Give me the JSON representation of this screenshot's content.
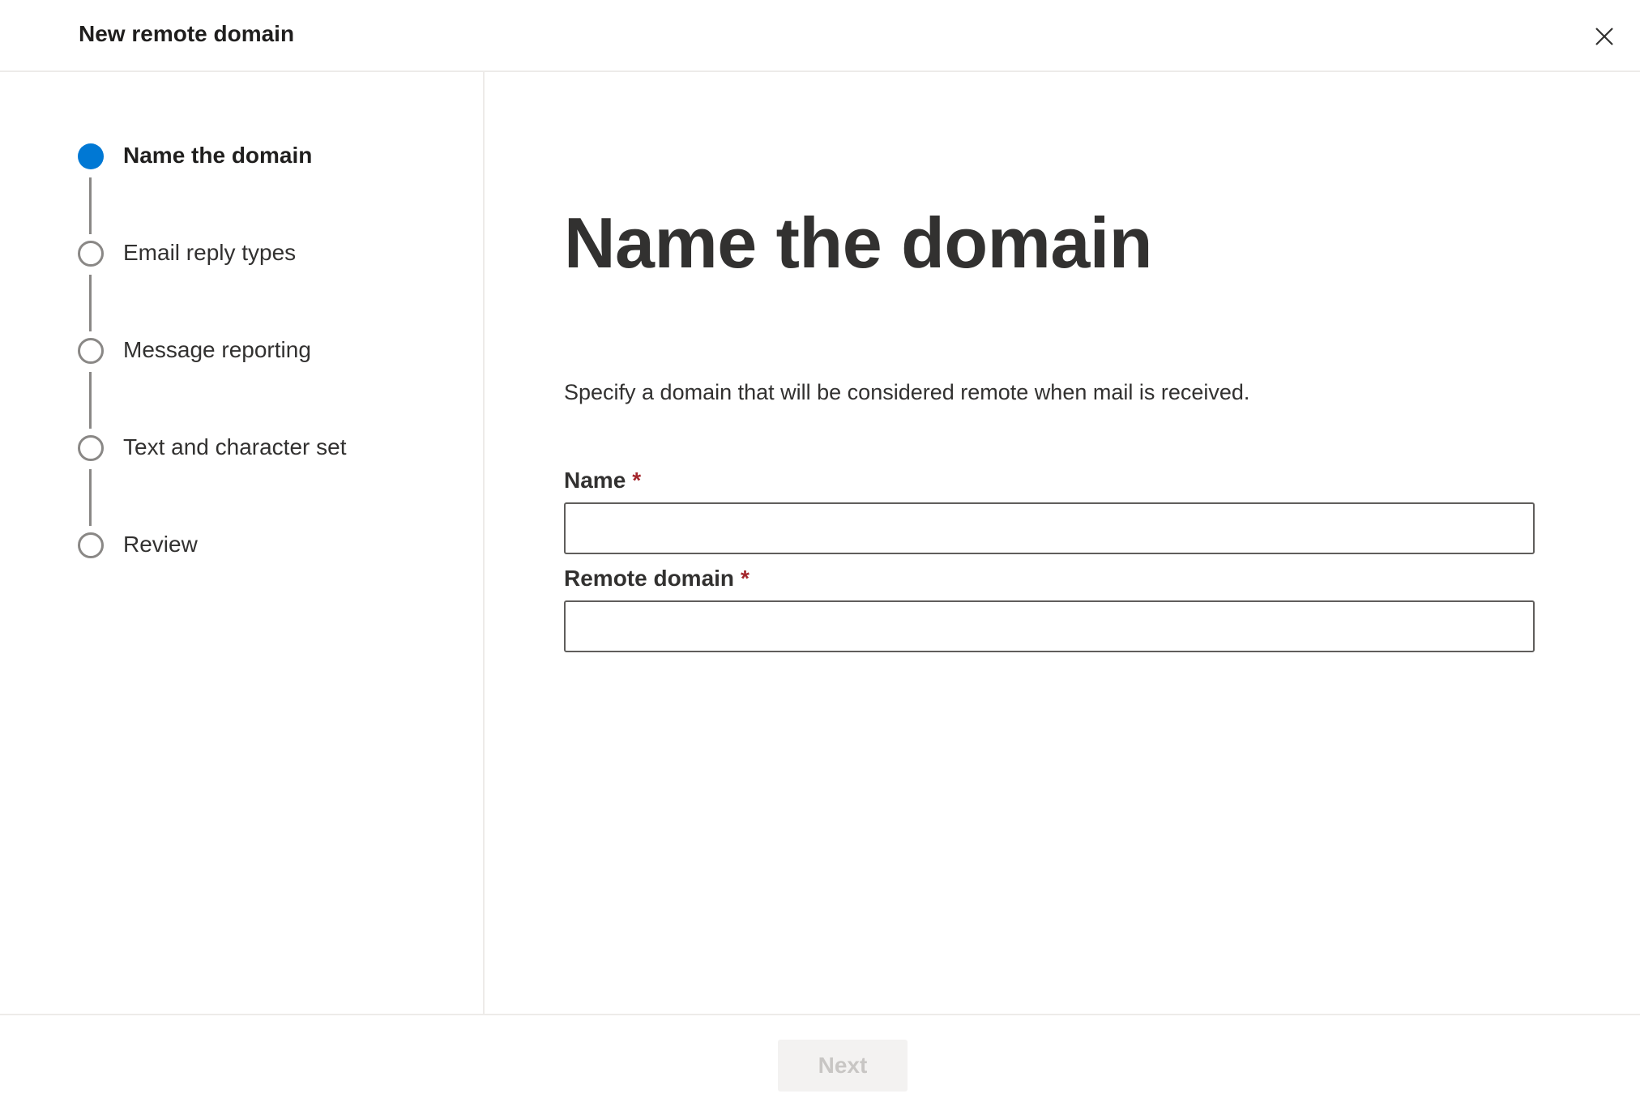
{
  "header": {
    "title": "New remote domain",
    "close_icon": "close-icon"
  },
  "steps": [
    {
      "label": "Name the domain",
      "state": "active"
    },
    {
      "label": "Email reply types",
      "state": "inactive"
    },
    {
      "label": "Message reporting",
      "state": "inactive"
    },
    {
      "label": "Text and character set",
      "state": "inactive"
    },
    {
      "label": "Review",
      "state": "inactive"
    }
  ],
  "main": {
    "title": "Name the domain",
    "description": "Specify a domain that will be considered remote when mail is received.",
    "fields": {
      "name": {
        "label": "Name",
        "required_mark": "*",
        "value": ""
      },
      "remote_domain": {
        "label": "Remote domain",
        "required_mark": "*",
        "value": ""
      }
    }
  },
  "footer": {
    "next_label": "Next",
    "next_enabled": false
  },
  "colors": {
    "accent": "#0078d4",
    "required": "#a4262c",
    "disabled_text": "#c8c6c4",
    "disabled_bg": "#f3f2f1"
  }
}
